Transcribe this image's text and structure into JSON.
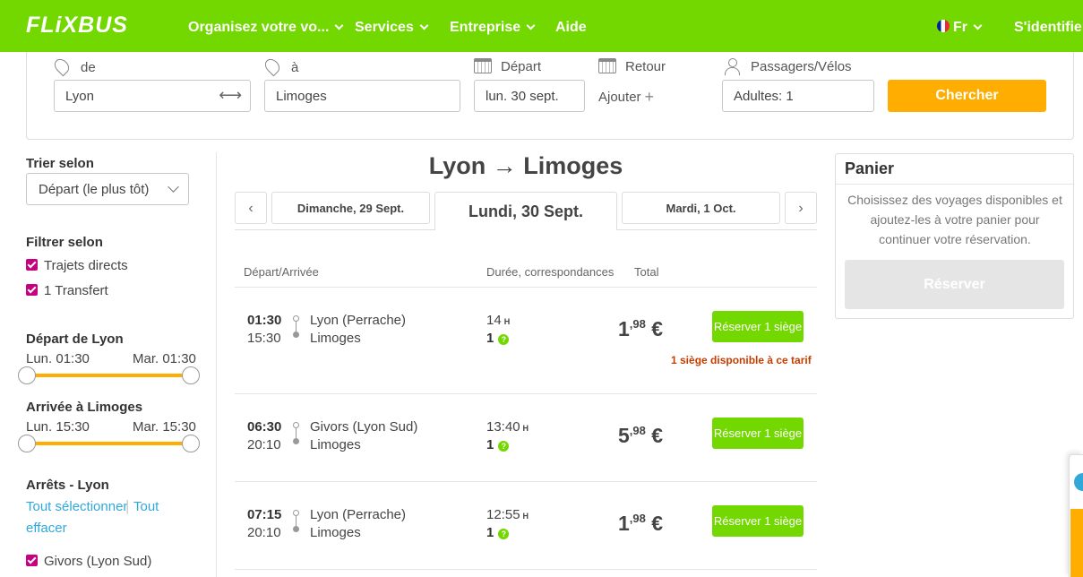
{
  "header": {
    "logo": "FLiXBUS",
    "nav": [
      "Organisez votre vo...",
      "Services",
      "Entreprise",
      "Aide"
    ],
    "language": "Fr",
    "login": "S'identifier"
  },
  "search": {
    "from_label": "de",
    "from_value": "Lyon",
    "swap_glyph": "⟷",
    "to_label": "à",
    "to_value": "Limoges",
    "depart_label": "Départ",
    "depart_value": "lun. 30 sept.",
    "return_label": "Retour",
    "return_add": "Ajouter",
    "passengers_label": "Passagers/Vélos",
    "passengers_value": "Adultes: 1",
    "search_button": "Chercher"
  },
  "filters": {
    "sort_title": "Trier selon",
    "sort_value": "Départ (le plus tôt)",
    "filter_title": "Filtrer selon",
    "options": [
      "Trajets directs",
      "1 Transfert"
    ],
    "departure_title": "Départ de Lyon",
    "departure_min": "Lun. 01:30",
    "departure_max": "Mar. 01:30",
    "arrival_title": "Arrivée à Limoges",
    "arrival_min": "Lun. 15:30",
    "arrival_max": "Mar. 15:30",
    "stops_title": "Arrêts - Lyon",
    "select_all": "Tout sélectionner",
    "separator": "|",
    "clear_all_1": "Tout",
    "clear_all_2": "effacer",
    "stop_option": "Givors (Lyon Sud)"
  },
  "results": {
    "route_title": "Lyon → Limoges",
    "prev_arrow": "‹",
    "next_arrow": "›",
    "date_prev": "Dimanche, 29 Sept.",
    "date_active": "Lundi, 30 Sept.",
    "date_next": "Mardi, 1 Oct.",
    "col_departure": "Départ/Arrivée",
    "col_duration": "Durée, correspondances",
    "col_total": "Total",
    "duration_unit": "H",
    "info_glyph": "?",
    "currency": "€",
    "book_label": "Réserver 1 siège",
    "rows": [
      {
        "dep": "01:30",
        "arr": "15:30",
        "from": "Lyon (Perrache)",
        "to": "Limoges",
        "duration": "14",
        "transfers": "1",
        "price_int": "1",
        "price_dec": ",98",
        "note": "1 siège disponible à ce tarif"
      },
      {
        "dep": "06:30",
        "arr": "20:10",
        "from": "Givors (Lyon Sud)",
        "to": "Limoges",
        "duration": "13:40",
        "transfers": "1",
        "price_int": "5",
        "price_dec": ",98",
        "note": ""
      },
      {
        "dep": "07:15",
        "arr": "20:10",
        "from": "Lyon (Perrache)",
        "to": "Limoges",
        "duration": "12:55",
        "transfers": "1",
        "price_int": "1",
        "price_dec": ",98",
        "note": ""
      }
    ]
  },
  "cart": {
    "title": "Panier",
    "text": "Choisissez des voyages disponibles et ajoutez-les à votre panier pour continuer votre réservation.",
    "button": "Réserver"
  }
}
